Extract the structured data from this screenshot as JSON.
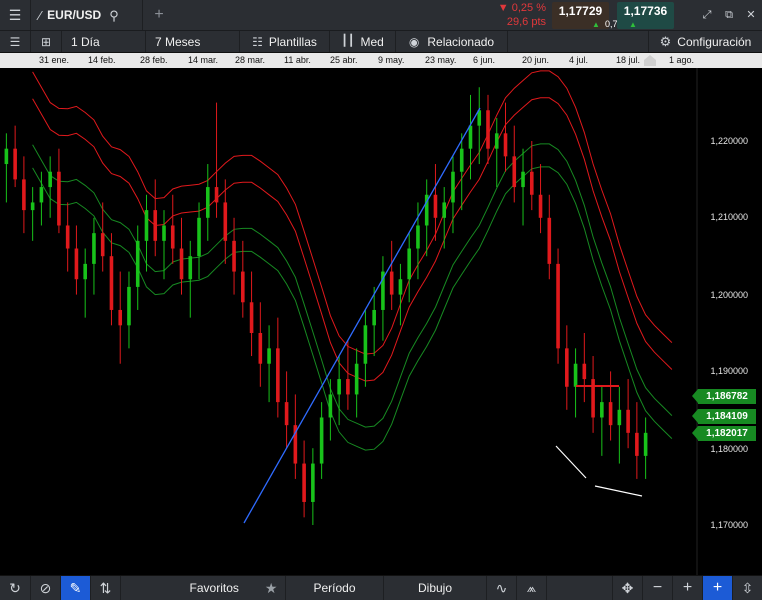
{
  "topbar": {
    "menu_icon": "hamburger-icon",
    "instrument": "EUR/USD",
    "change_pct": "▼ 0,25 %",
    "change_pts": "29,6 pts",
    "bid": "1,17729",
    "ask": "1,17736",
    "spread": "0,7",
    "colors": {
      "down": "#e0383b",
      "up": "#2fbf3a",
      "bid_bg": "#3b2f26",
      "ask_bg": "#1f4a45"
    }
  },
  "toolbar": {
    "interval": "1 Día",
    "range": "7 Meses",
    "templates": "Plantillas",
    "chart_type": "Med",
    "related": "Relacionado",
    "settings": "Configuración"
  },
  "date_axis": [
    "31 ene.",
    "14 feb.",
    "28 feb.",
    "14 mar.",
    "28 mar.",
    "11 abr.",
    "25 abr.",
    "9 may.",
    "23 may.",
    "6 jun.",
    "20 jun.",
    "4 jul.",
    "18 jul.",
    "1 ago."
  ],
  "price_axis": [
    "1,220000",
    "1,210000",
    "1,200000",
    "1,190000",
    "1,180000",
    "1,170000"
  ],
  "price_tags": [
    "1,186782",
    "1,184109",
    "1,182017"
  ],
  "bottombar": {
    "favorites": "Favoritos",
    "period": "Período",
    "drawing": "Dibujo"
  },
  "chart_data": {
    "type": "candlestick",
    "symbol": "EUR/USD",
    "ylim": [
      1.168,
      1.236
    ],
    "ticks_y": [
      1.22,
      1.21,
      1.2,
      1.19,
      1.18,
      1.17
    ],
    "up_color": "#18c21a",
    "down_color": "#e0191c",
    "ohlc": [
      [
        1.217,
        1.221,
        1.212,
        1.219
      ],
      [
        1.219,
        1.222,
        1.214,
        1.215
      ],
      [
        1.215,
        1.218,
        1.208,
        1.211
      ],
      [
        1.211,
        1.214,
        1.207,
        1.212
      ],
      [
        1.212,
        1.216,
        1.209,
        1.214
      ],
      [
        1.214,
        1.218,
        1.21,
        1.216
      ],
      [
        1.216,
        1.219,
        1.208,
        1.209
      ],
      [
        1.209,
        1.212,
        1.203,
        1.206
      ],
      [
        1.206,
        1.209,
        1.2,
        1.202
      ],
      [
        1.202,
        1.206,
        1.197,
        1.204
      ],
      [
        1.204,
        1.21,
        1.2,
        1.208
      ],
      [
        1.208,
        1.212,
        1.203,
        1.205
      ],
      [
        1.205,
        1.208,
        1.196,
        1.198
      ],
      [
        1.198,
        1.203,
        1.191,
        1.196
      ],
      [
        1.196,
        1.203,
        1.193,
        1.201
      ],
      [
        1.201,
        1.209,
        1.198,
        1.207
      ],
      [
        1.207,
        1.213,
        1.203,
        1.211
      ],
      [
        1.211,
        1.215,
        1.205,
        1.207
      ],
      [
        1.207,
        1.211,
        1.202,
        1.209
      ],
      [
        1.209,
        1.213,
        1.204,
        1.206
      ],
      [
        1.206,
        1.21,
        1.2,
        1.202
      ],
      [
        1.202,
        1.207,
        1.197,
        1.205
      ],
      [
        1.205,
        1.212,
        1.202,
        1.21
      ],
      [
        1.21,
        1.217,
        1.207,
        1.214
      ],
      [
        1.214,
        1.225,
        1.21,
        1.212
      ],
      [
        1.212,
        1.215,
        1.204,
        1.207
      ],
      [
        1.207,
        1.21,
        1.2,
        1.203
      ],
      [
        1.203,
        1.207,
        1.197,
        1.199
      ],
      [
        1.199,
        1.203,
        1.192,
        1.195
      ],
      [
        1.195,
        1.199,
        1.188,
        1.191
      ],
      [
        1.191,
        1.196,
        1.186,
        1.193
      ],
      [
        1.193,
        1.197,
        1.184,
        1.186
      ],
      [
        1.186,
        1.19,
        1.18,
        1.183
      ],
      [
        1.183,
        1.187,
        1.176,
        1.178
      ],
      [
        1.178,
        1.181,
        1.171,
        1.173
      ],
      [
        1.173,
        1.18,
        1.17,
        1.178
      ],
      [
        1.178,
        1.186,
        1.176,
        1.184
      ],
      [
        1.184,
        1.189,
        1.181,
        1.187
      ],
      [
        1.187,
        1.192,
        1.183,
        1.189
      ],
      [
        1.189,
        1.194,
        1.185,
        1.187
      ],
      [
        1.187,
        1.193,
        1.184,
        1.191
      ],
      [
        1.191,
        1.198,
        1.188,
        1.196
      ],
      [
        1.196,
        1.201,
        1.192,
        1.198
      ],
      [
        1.198,
        1.205,
        1.194,
        1.203
      ],
      [
        1.203,
        1.207,
        1.198,
        1.2
      ],
      [
        1.2,
        1.204,
        1.196,
        1.202
      ],
      [
        1.202,
        1.208,
        1.199,
        1.206
      ],
      [
        1.206,
        1.212,
        1.202,
        1.209
      ],
      [
        1.209,
        1.215,
        1.205,
        1.213
      ],
      [
        1.213,
        1.217,
        1.207,
        1.21
      ],
      [
        1.21,
        1.214,
        1.206,
        1.212
      ],
      [
        1.212,
        1.218,
        1.208,
        1.216
      ],
      [
        1.216,
        1.221,
        1.211,
        1.219
      ],
      [
        1.219,
        1.226,
        1.215,
        1.222
      ],
      [
        1.222,
        1.227,
        1.217,
        1.224
      ],
      [
        1.224,
        1.226,
        1.217,
        1.219
      ],
      [
        1.219,
        1.223,
        1.214,
        1.221
      ],
      [
        1.221,
        1.225,
        1.216,
        1.218
      ],
      [
        1.218,
        1.222,
        1.212,
        1.214
      ],
      [
        1.214,
        1.219,
        1.209,
        1.216
      ],
      [
        1.216,
        1.22,
        1.211,
        1.213
      ],
      [
        1.213,
        1.217,
        1.208,
        1.21
      ],
      [
        1.21,
        1.213,
        1.202,
        1.204
      ],
      [
        1.204,
        1.206,
        1.191,
        1.193
      ],
      [
        1.193,
        1.196,
        1.185,
        1.188
      ],
      [
        1.188,
        1.193,
        1.184,
        1.191
      ],
      [
        1.191,
        1.195,
        1.186,
        1.189
      ],
      [
        1.189,
        1.192,
        1.182,
        1.184
      ],
      [
        1.184,
        1.188,
        1.179,
        1.186
      ],
      [
        1.186,
        1.19,
        1.181,
        1.183
      ],
      [
        1.183,
        1.188,
        1.178,
        1.185
      ],
      [
        1.185,
        1.189,
        1.18,
        1.182
      ],
      [
        1.182,
        1.186,
        1.176,
        1.179
      ],
      [
        1.179,
        1.184,
        1.176,
        1.182
      ]
    ],
    "overlays": {
      "red_bands": "upper envelope",
      "green_bands": "lower envelope",
      "trendline_color": "#2f6bff",
      "horizontal_line_color": "#e0191c",
      "white_lines": "support/resistance drawings"
    }
  }
}
